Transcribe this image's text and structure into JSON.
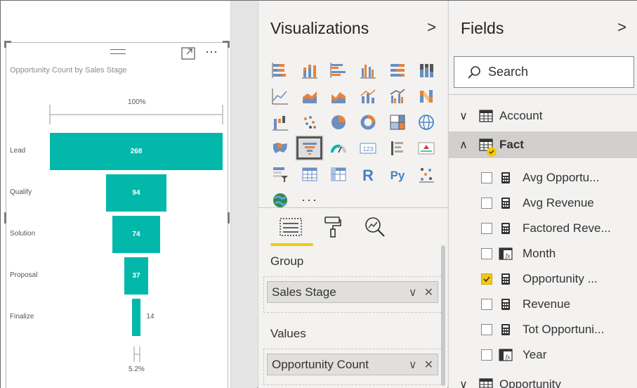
{
  "colors": {
    "funnel": "#01b8aa",
    "accent": "#f2c811"
  },
  "canvas": {
    "visual_title": "Opportunity Count by Sales Stage",
    "more_label": "⋯",
    "top_pct": "100%",
    "bottom_pct": "5.2%"
  },
  "chart_data": {
    "type": "bar",
    "title": "Opportunity Count by Sales Stage",
    "categories": [
      "Lead",
      "Qualify",
      "Solution",
      "Proposal",
      "Finalize"
    ],
    "values": [
      268,
      94,
      74,
      37,
      14
    ],
    "top_label": "100%",
    "bottom_label": "5.2%"
  },
  "visualizations": {
    "title": "Visualizations",
    "chevron": ">",
    "more": "···",
    "tabs": [
      "fields-tab",
      "format-tab",
      "analytics-tab"
    ],
    "wells": [
      {
        "label": "Group",
        "field": "Sales Stage",
        "chevron": "∨",
        "remove": "✕"
      },
      {
        "label": "Values",
        "field": "Opportunity Count",
        "chevron": "∨",
        "remove": "✕"
      }
    ]
  },
  "fields": {
    "title": "Fields",
    "chevron": ">",
    "search_placeholder": "Search",
    "tables": [
      {
        "name": "Account",
        "expanded": false,
        "caret": "∨"
      },
      {
        "name": "Fact",
        "expanded": true,
        "caret": "∧"
      },
      {
        "name": "Opportunity",
        "expanded": false,
        "caret": "∨"
      }
    ],
    "fact_fields": [
      {
        "name": "Avg Opportu...",
        "checked": false,
        "icon": "calculator-icon"
      },
      {
        "name": "Avg Revenue",
        "checked": false,
        "icon": "calculator-icon"
      },
      {
        "name": "Factored Reve...",
        "checked": false,
        "icon": "calculator-icon"
      },
      {
        "name": "Month",
        "checked": false,
        "icon": "calculated-column-icon"
      },
      {
        "name": "Opportunity ...",
        "checked": true,
        "icon": "calculator-icon"
      },
      {
        "name": "Revenue",
        "checked": false,
        "icon": "calculator-icon"
      },
      {
        "name": "Tot Opportuni...",
        "checked": false,
        "icon": "calculator-icon"
      },
      {
        "name": "Year",
        "checked": false,
        "icon": "calculated-column-icon"
      }
    ]
  }
}
